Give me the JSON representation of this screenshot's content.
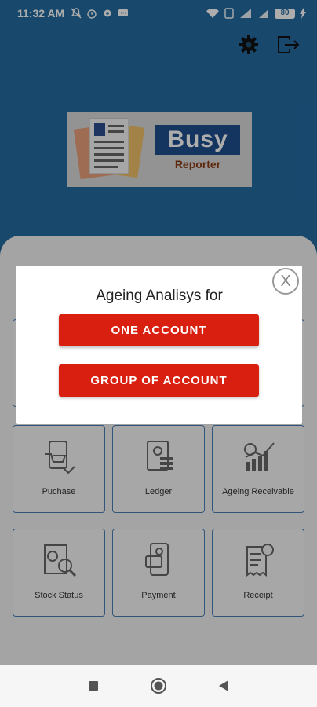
{
  "status_bar": {
    "time": "11:32 AM",
    "battery": "80"
  },
  "header": {
    "settings_icon": "gear-icon",
    "logout_icon": "logout-icon"
  },
  "logo": {
    "line1": "Busy",
    "line2": "Reporter"
  },
  "tiles": [
    {
      "label": "Puchase",
      "icon": "purchase-icon"
    },
    {
      "label": "Ledger",
      "icon": "ledger-icon"
    },
    {
      "label": "Ageing Receivable",
      "icon": "ageing-receivable-icon"
    },
    {
      "label": "Stock Status",
      "icon": "stock-status-icon"
    },
    {
      "label": "Payment",
      "icon": "payment-icon"
    },
    {
      "label": "Receipt",
      "icon": "receipt-icon"
    }
  ],
  "dialog": {
    "title": "Ageing Analisys for",
    "button_one": "ONE ACCOUNT",
    "button_group": "GROUP OF ACCOUNT",
    "close_label": "X"
  },
  "nav": {
    "recents": "recents-icon",
    "home": "home-icon",
    "back": "back-icon"
  },
  "colors": {
    "header_blue": "#246aa0",
    "dialog_button_red": "#d92010",
    "tile_border": "#4a7fb5"
  }
}
